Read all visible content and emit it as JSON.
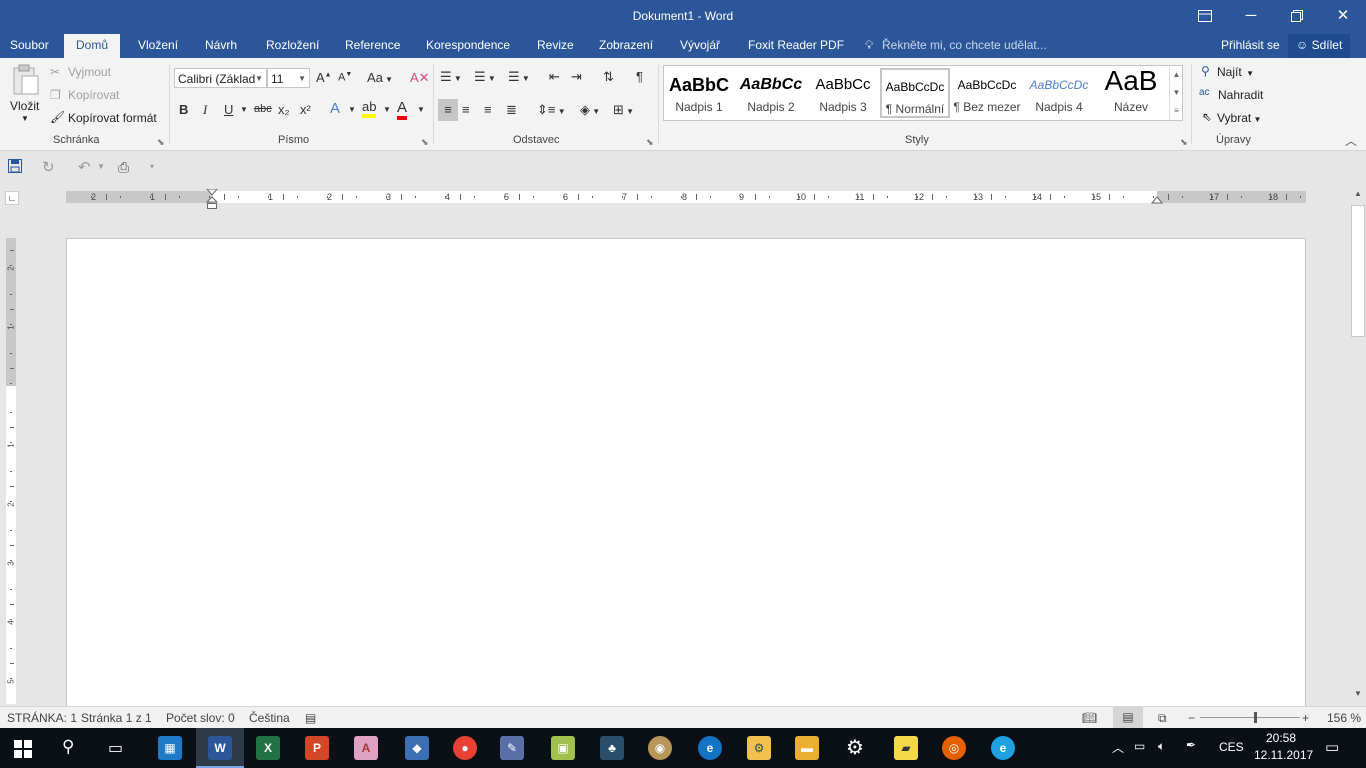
{
  "window": {
    "title": "Dokument1 - Word"
  },
  "tabs": {
    "file": "Soubor",
    "items": [
      "Domů",
      "Vložení",
      "Návrh",
      "Rozložení",
      "Reference",
      "Korespondence",
      "Revize",
      "Zobrazení",
      "Vývojář",
      "Foxit Reader PDF"
    ],
    "tell_me": "Řekněte mi, co chcete udělat...",
    "signin": "Přihlásit se",
    "share": "Sdílet"
  },
  "ribbon": {
    "clipboard": {
      "paste": "Vložit",
      "cut": "Vyjmout",
      "copy": "Kopírovat",
      "format_painter": "Kopírovat formát",
      "label": "Schránka"
    },
    "font": {
      "name": "Calibri (Základ",
      "size": "11",
      "case": "Aa",
      "label": "Písmo",
      "bold": "B",
      "italic": "I",
      "underline": "U",
      "strike": "abc",
      "sub": "x₂",
      "sup": "x²"
    },
    "paragraph": {
      "label": "Odstavec"
    },
    "styles": {
      "label": "Styly",
      "items": [
        {
          "preview": "AaBbC",
          "name": "Nadpis 1"
        },
        {
          "preview": "AaBbCc",
          "name": "Nadpis 2"
        },
        {
          "preview": "AaBbCc",
          "name": "Nadpis 3"
        },
        {
          "preview": "AaBbCcDc",
          "name": "¶ Normální"
        },
        {
          "preview": "AaBbCcDc",
          "name": "¶ Bez mezer"
        },
        {
          "preview": "AaBbCcDc",
          "name": "Nadpis 4"
        },
        {
          "preview": "AaB",
          "name": "Název"
        }
      ]
    },
    "editing": {
      "find": "Najít",
      "replace": "Nahradit",
      "select": "Vybrat",
      "label": "Úpravy"
    }
  },
  "ruler": {
    "h_numbers": [
      "2",
      "1",
      "1",
      "2",
      "3",
      "4",
      "5",
      "6",
      "7",
      "8",
      "9",
      "10",
      "11",
      "12",
      "13",
      "14",
      "15",
      "17",
      "18"
    ],
    "v_numbers": [
      "2",
      "1",
      "1",
      "2",
      "3",
      "4",
      "5"
    ]
  },
  "status": {
    "section": "STRÁNKA: 1",
    "page": "Stránka 1 z 1",
    "words": "Počet slov: 0",
    "language": "Čeština",
    "zoom": "156 %"
  },
  "taskbar": {
    "language": "CES",
    "time": "20:58",
    "date": "12.11.2017"
  }
}
